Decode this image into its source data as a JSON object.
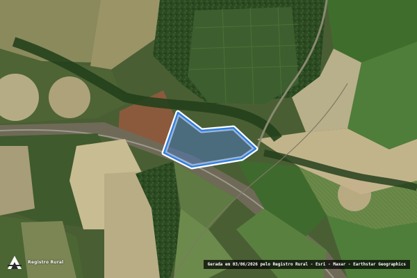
{
  "map": {
    "logo": {
      "text": "Registro Rural",
      "icon": "registro-rural-logo-icon"
    },
    "attribution": "Gerada em 03/06/2026 pelo Registro Rural - Esri - Maxar - Earthstar Geographics",
    "property_outline_color": "#ffffff",
    "property_border_color": "#2f7fe0",
    "property_fill_color": "#4d79b8"
  }
}
